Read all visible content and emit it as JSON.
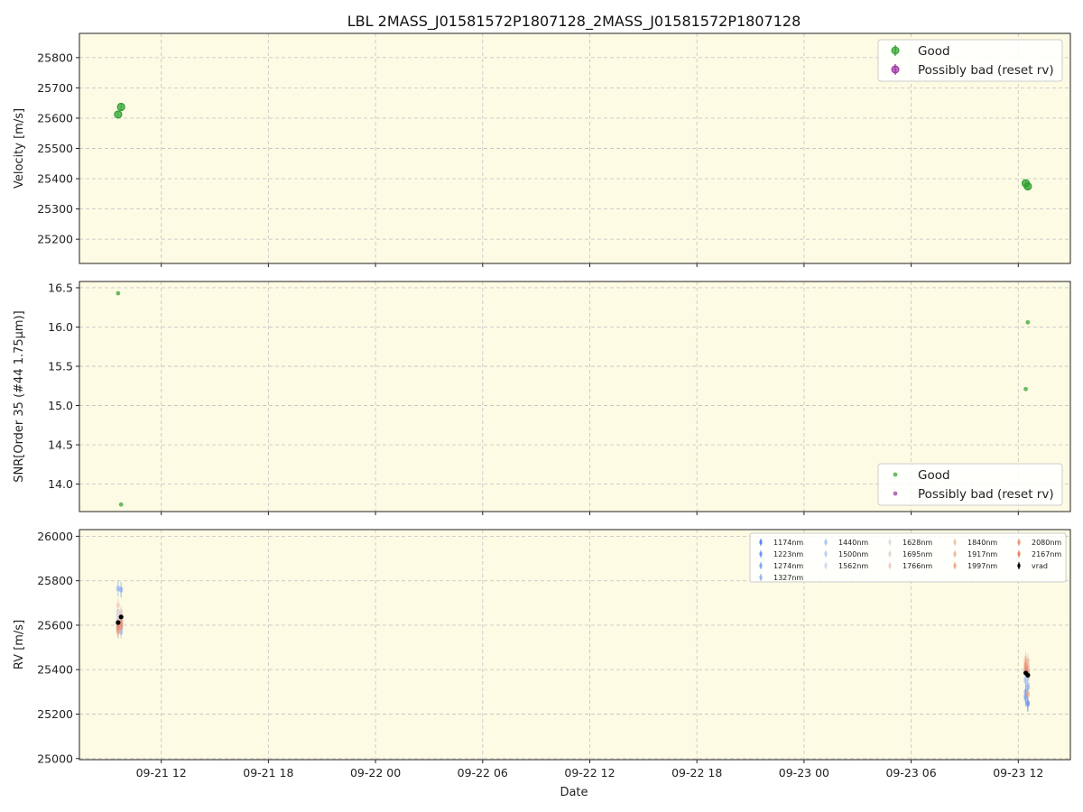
{
  "title": "LBL 2MASS_J01581572P1807128_2MASS_J01581572P1807128",
  "x_axis": {
    "label": "Date",
    "min": "2023-09-21T07:25:00",
    "max": "2023-09-23T14:55:00",
    "ticks": [
      {
        "t": "2023-09-21T12:00:00",
        "label": "09-21 12"
      },
      {
        "t": "2023-09-21T18:00:00",
        "label": "09-21 18"
      },
      {
        "t": "2023-09-22T00:00:00",
        "label": "09-22 00"
      },
      {
        "t": "2023-09-22T06:00:00",
        "label": "09-22 06"
      },
      {
        "t": "2023-09-22T12:00:00",
        "label": "09-22 12"
      },
      {
        "t": "2023-09-22T18:00:00",
        "label": "09-22 18"
      },
      {
        "t": "2023-09-23T00:00:00",
        "label": "09-23 00"
      },
      {
        "t": "2023-09-23T06:00:00",
        "label": "09-23 06"
      },
      {
        "t": "2023-09-23T12:00:00",
        "label": "09-23 12"
      }
    ]
  },
  "colors": {
    "background": "#fdfbe3",
    "good": "#2ca02c",
    "bad": "#9b30a0",
    "vrad": "#000000",
    "grid": "#c8c8c8"
  },
  "chart_data": [
    {
      "type": "scatter",
      "panel": "velocity",
      "ylabel": "Velocity [m/s]",
      "ylim": [
        25120,
        25880
      ],
      "yticks": [
        25200,
        25300,
        25400,
        25500,
        25600,
        25700,
        25800
      ],
      "grid": true,
      "legend": {
        "placement": "top-right",
        "entries": [
          "Good",
          "Possibly bad (reset rv)"
        ]
      },
      "series": [
        {
          "name": "Good",
          "points": [
            {
              "t": "2023-09-21T09:35:00",
              "y": 25612,
              "err": 10
            },
            {
              "t": "2023-09-21T09:45:00",
              "y": 25637,
              "err": 10
            },
            {
              "t": "2023-09-23T12:25:00",
              "y": 25385,
              "err": 10
            },
            {
              "t": "2023-09-23T12:32:00",
              "y": 25375,
              "err": 10
            }
          ]
        },
        {
          "name": "Possibly bad (reset rv)",
          "points": []
        }
      ]
    },
    {
      "type": "scatter",
      "panel": "snr",
      "ylabel": "SNR[Order 35 (#44 1.75μm)]",
      "ylim": [
        13.65,
        16.58
      ],
      "yticks": [
        14.0,
        14.5,
        15.0,
        15.5,
        16.0,
        16.5
      ],
      "grid": true,
      "legend": {
        "placement": "bottom-right",
        "entries": [
          "Good",
          "Possibly bad (reset rv)"
        ]
      },
      "series": [
        {
          "name": "Good",
          "points": [
            {
              "t": "2023-09-21T09:35:00",
              "y": 16.43
            },
            {
              "t": "2023-09-21T09:45:00",
              "y": 13.74
            },
            {
              "t": "2023-09-23T12:25:00",
              "y": 15.21
            },
            {
              "t": "2023-09-23T12:32:00",
              "y": 16.06
            }
          ]
        },
        {
          "name": "Possibly bad (reset rv)",
          "points": []
        }
      ]
    },
    {
      "type": "scatter",
      "panel": "rv",
      "ylabel": "RV [m/s]",
      "ylim": [
        24995,
        26030
      ],
      "yticks": [
        25000,
        25200,
        25400,
        25600,
        25800,
        26000
      ],
      "grid": true,
      "legend": {
        "placement": "top-right",
        "columns": 5
      },
      "series": [
        {
          "name": "1174nm",
          "color": "#5d86f0",
          "points": [
            {
              "t": "2023-09-21T09:35:00",
              "y": 25600,
              "err": 35
            },
            {
              "t": "2023-09-21T09:45:00",
              "y": 25640,
              "err": 35
            },
            {
              "t": "2023-09-23T12:25:00",
              "y": 25280,
              "err": 35
            },
            {
              "t": "2023-09-23T12:32:00",
              "y": 25250,
              "err": 35
            }
          ]
        },
        {
          "name": "1223nm",
          "color": "#6e97f5",
          "points": [
            {
              "t": "2023-09-21T09:35:00",
              "y": 25580,
              "err": 35
            },
            {
              "t": "2023-09-21T09:45:00",
              "y": 25760,
              "err": 35
            },
            {
              "t": "2023-09-23T12:25:00",
              "y": 25300,
              "err": 35
            },
            {
              "t": "2023-09-23T12:32:00",
              "y": 25245,
              "err": 35
            }
          ]
        },
        {
          "name": "1274nm",
          "color": "#80a7f7",
          "points": [
            {
              "t": "2023-09-21T09:35:00",
              "y": 25765,
              "err": 35
            },
            {
              "t": "2023-09-21T09:45:00",
              "y": 25590,
              "err": 35
            },
            {
              "t": "2023-09-23T12:25:00",
              "y": 25270,
              "err": 35
            },
            {
              "t": "2023-09-23T12:32:00",
              "y": 25320,
              "err": 35
            }
          ]
        },
        {
          "name": "1327nm",
          "color": "#93b5f7",
          "points": [
            {
              "t": "2023-09-21T09:35:00",
              "y": 25620,
              "err": 30
            },
            {
              "t": "2023-09-21T09:45:00",
              "y": 25570,
              "err": 30
            },
            {
              "t": "2023-09-23T12:25:00",
              "y": 25350,
              "err": 30
            },
            {
              "t": "2023-09-23T12:32:00",
              "y": 25330,
              "err": 30
            }
          ]
        },
        {
          "name": "1440nm",
          "color": "#a8c4f5",
          "points": [
            {
              "t": "2023-09-21T09:35:00",
              "y": 25640,
              "err": 30
            },
            {
              "t": "2023-09-21T09:45:00",
              "y": 25600,
              "err": 30
            },
            {
              "t": "2023-09-23T12:25:00",
              "y": 25360,
              "err": 30
            },
            {
              "t": "2023-09-23T12:32:00",
              "y": 25380,
              "err": 30
            }
          ]
        },
        {
          "name": "1500nm",
          "color": "#bcd0f2",
          "points": [
            {
              "t": "2023-09-21T09:35:00",
              "y": 25660,
              "err": 30
            },
            {
              "t": "2023-09-21T09:45:00",
              "y": 25620,
              "err": 30
            },
            {
              "t": "2023-09-23T12:25:00",
              "y": 25390,
              "err": 30
            },
            {
              "t": "2023-09-23T12:32:00",
              "y": 25360,
              "err": 30
            }
          ]
        },
        {
          "name": "1562nm",
          "color": "#cdd9ee",
          "points": [
            {
              "t": "2023-09-21T09:35:00",
              "y": 25600,
              "err": 30
            },
            {
              "t": "2023-09-21T09:45:00",
              "y": 25650,
              "err": 30
            },
            {
              "t": "2023-09-23T12:25:00",
              "y": 25400,
              "err": 30
            },
            {
              "t": "2023-09-23T12:32:00",
              "y": 25370,
              "err": 30
            }
          ]
        },
        {
          "name": "1628nm",
          "color": "#dcdedf",
          "points": [
            {
              "t": "2023-09-21T09:35:00",
              "y": 25630,
              "err": 30
            },
            {
              "t": "2023-09-21T09:45:00",
              "y": 25610,
              "err": 30
            },
            {
              "t": "2023-09-23T12:25:00",
              "y": 25410,
              "err": 30
            },
            {
              "t": "2023-09-23T12:32:00",
              "y": 25395,
              "err": 30
            }
          ]
        },
        {
          "name": "1695nm",
          "color": "#e5d8cf",
          "points": [
            {
              "t": "2023-09-21T09:35:00",
              "y": 25650,
              "err": 30
            },
            {
              "t": "2023-09-21T09:45:00",
              "y": 25630,
              "err": 30
            },
            {
              "t": "2023-09-23T12:25:00",
              "y": 25420,
              "err": 30
            },
            {
              "t": "2023-09-23T12:32:00",
              "y": 25400,
              "err": 30
            }
          ]
        },
        {
          "name": "1766nm",
          "color": "#ebd0c0",
          "points": [
            {
              "t": "2023-09-21T09:35:00",
              "y": 25610,
              "err": 30
            },
            {
              "t": "2023-09-21T09:45:00",
              "y": 25660,
              "err": 30
            },
            {
              "t": "2023-09-23T12:25:00",
              "y": 25440,
              "err": 30
            },
            {
              "t": "2023-09-23T12:32:00",
              "y": 25410,
              "err": 30
            }
          ]
        },
        {
          "name": "1840nm",
          "color": "#f0c4ad",
          "points": [
            {
              "t": "2023-09-21T09:35:00",
              "y": 25690,
              "err": 30
            },
            {
              "t": "2023-09-21T09:45:00",
              "y": 25640,
              "err": 30
            },
            {
              "t": "2023-09-23T12:25:00",
              "y": 25450,
              "err": 30
            },
            {
              "t": "2023-09-23T12:32:00",
              "y": 25420,
              "err": 30
            }
          ]
        },
        {
          "name": "1917nm",
          "color": "#f2b89c",
          "points": [
            {
              "t": "2023-09-21T09:35:00",
              "y": 25580,
              "err": 30
            },
            {
              "t": "2023-09-21T09:45:00",
              "y": 25620,
              "err": 30
            },
            {
              "t": "2023-09-23T12:25:00",
              "y": 25430,
              "err": 30
            },
            {
              "t": "2023-09-23T12:32:00",
              "y": 25440,
              "err": 30
            }
          ]
        },
        {
          "name": "1997nm",
          "color": "#f2a98a",
          "points": [
            {
              "t": "2023-09-21T09:35:00",
              "y": 25570,
              "err": 30
            },
            {
              "t": "2023-09-21T09:45:00",
              "y": 25600,
              "err": 30
            },
            {
              "t": "2023-09-23T12:25:00",
              "y": 25410,
              "err": 30
            },
            {
              "t": "2023-09-23T12:32:00",
              "y": 25380,
              "err": 30
            }
          ]
        },
        {
          "name": "2080nm",
          "color": "#ef9779",
          "points": [
            {
              "t": "2023-09-21T09:35:00",
              "y": 25600,
              "err": 30
            },
            {
              "t": "2023-09-21T09:45:00",
              "y": 25590,
              "err": 30
            },
            {
              "t": "2023-09-23T12:25:00",
              "y": 25420,
              "err": 30
            },
            {
              "t": "2023-09-23T12:32:00",
              "y": 25290,
              "err": 30
            }
          ]
        },
        {
          "name": "2167nm",
          "color": "#e8846a",
          "points": [
            {
              "t": "2023-09-21T09:35:00",
              "y": 25590,
              "err": 30
            },
            {
              "t": "2023-09-21T09:45:00",
              "y": 25610,
              "err": 30
            },
            {
              "t": "2023-09-23T12:25:00",
              "y": 25400,
              "err": 30
            },
            {
              "t": "2023-09-23T12:32:00",
              "y": 25390,
              "err": 30
            }
          ]
        },
        {
          "name": "vrad",
          "color": "#000000",
          "points": [
            {
              "t": "2023-09-21T09:35:00",
              "y": 25612,
              "err": 8
            },
            {
              "t": "2023-09-21T09:45:00",
              "y": 25637,
              "err": 8
            },
            {
              "t": "2023-09-23T12:25:00",
              "y": 25385,
              "err": 8
            },
            {
              "t": "2023-09-23T12:32:00",
              "y": 25375,
              "err": 8
            }
          ]
        }
      ]
    }
  ]
}
